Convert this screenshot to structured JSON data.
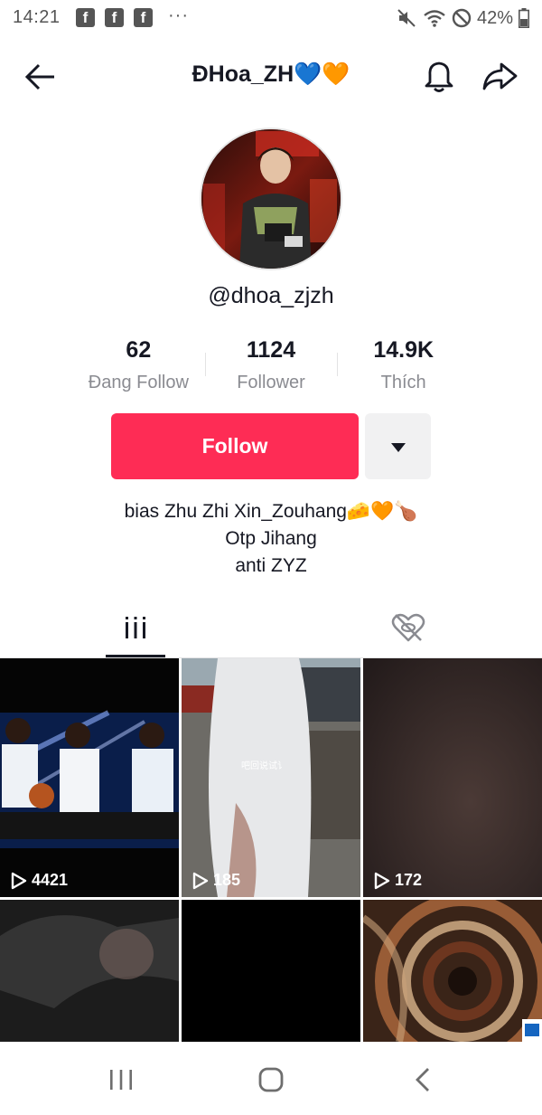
{
  "status_bar": {
    "time": "14:21",
    "notif_icons": [
      "facebook-icon",
      "facebook-icon",
      "facebook-icon"
    ],
    "more": "···",
    "battery": "42%"
  },
  "header": {
    "title": "ĐHoa_ZH💙🧡",
    "icons": [
      "back-arrow-icon",
      "bell-icon",
      "share-icon"
    ]
  },
  "profile": {
    "username": "@dhoa_zjzh"
  },
  "stats": [
    {
      "value": "62",
      "label": "Đang Follow"
    },
    {
      "value": "1124",
      "label": "Follower"
    },
    {
      "value": "14.9K",
      "label": "Thích"
    }
  ],
  "actions": {
    "follow_label": "Follow",
    "accent": "#fe2c55"
  },
  "bio": {
    "lines": [
      "bias Zhu Zhi Xin_Zouhang🧀🧡🍗",
      "Otp Jihang",
      "anti ZYZ"
    ]
  },
  "tabs": {
    "icons": [
      "grid-icon",
      "liked-hidden-icon"
    ]
  },
  "videos": [
    {
      "views": "4421"
    },
    {
      "views": "185"
    },
    {
      "views": "172"
    },
    {
      "views": ""
    },
    {
      "views": ""
    },
    {
      "views": ""
    }
  ],
  "nav": {
    "icons": [
      "recent-apps-icon",
      "home-icon",
      "back-icon"
    ]
  }
}
